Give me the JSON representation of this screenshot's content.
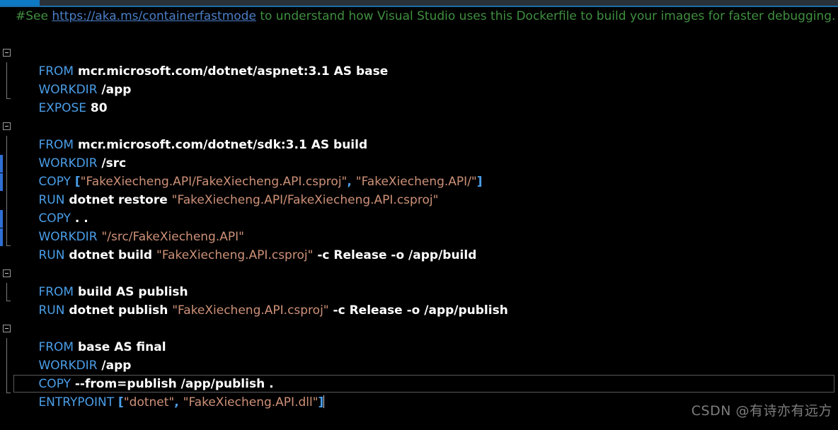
{
  "editor": {
    "background_color": "#000000",
    "scrollbar": {
      "thumb_color": "#0e7ac4",
      "track_color": "#293138"
    },
    "colors": {
      "keyword": "#4a9ee8",
      "argument": "#ffffff",
      "string": "#ce9178",
      "comment": "#3f8f3f",
      "link": "#4a7fc8",
      "change_bar": "#2e6fd4"
    }
  },
  "comment_line": {
    "hash_see": "#See ",
    "url": "https://aka.ms/containerfastmode",
    "tail": " to understand how Visual Studio uses this Dockerfile to build your images for faster debugging."
  },
  "lines": [
    {
      "kw": "FROM",
      "arg": " mcr.microsoft.com/dotnet/aspnet:3.1 AS base"
    },
    {
      "kw": "WORKDIR",
      "arg": " /app"
    },
    {
      "kw": "EXPOSE",
      "arg": " 80"
    },
    {
      "kw": "FROM",
      "arg": " mcr.microsoft.com/dotnet/sdk:3.1 AS build"
    },
    {
      "kw": "WORKDIR",
      "arg": " /src"
    },
    {
      "kw": "COPY",
      "punct_open": " [",
      "str1": "\"FakeXiecheng.API/FakeXiecheng.API.csproj\"",
      "sep": ", ",
      "str2": "\"FakeXiecheng.API/\"",
      "punct_close": "]"
    },
    {
      "kw": "RUN",
      "arg": " dotnet restore ",
      "str1": "\"FakeXiecheng.API/FakeXiecheng.API.csproj\""
    },
    {
      "kw": "COPY",
      "arg": " . ."
    },
    {
      "kw": "WORKDIR",
      "arg": " ",
      "str1": "\"/src/FakeXiecheng.API\""
    },
    {
      "kw": "RUN",
      "arg": " dotnet build ",
      "str1": "\"FakeXiecheng.API.csproj\"",
      "arg2": " -c Release -o /app/build"
    },
    {
      "kw": "FROM",
      "arg": " build AS publish"
    },
    {
      "kw": "RUN",
      "arg": " dotnet publish ",
      "str1": "\"FakeXiecheng.API.csproj\"",
      "arg2": " -c Release -o /app/publish"
    },
    {
      "kw": "FROM",
      "arg": " base AS final"
    },
    {
      "kw": "WORKDIR",
      "arg": " /app"
    },
    {
      "kw": "COPY",
      "arg": " --from=publish /app/publish ."
    },
    {
      "kw": "ENTRYPOINT",
      "punct_open": " [",
      "str1": "\"dotnet\"",
      "sep": ", ",
      "str2": "\"FakeXiecheng.API.dll\"",
      "punct_close": "]"
    }
  ],
  "watermark": "CSDN @有诗亦有远方"
}
